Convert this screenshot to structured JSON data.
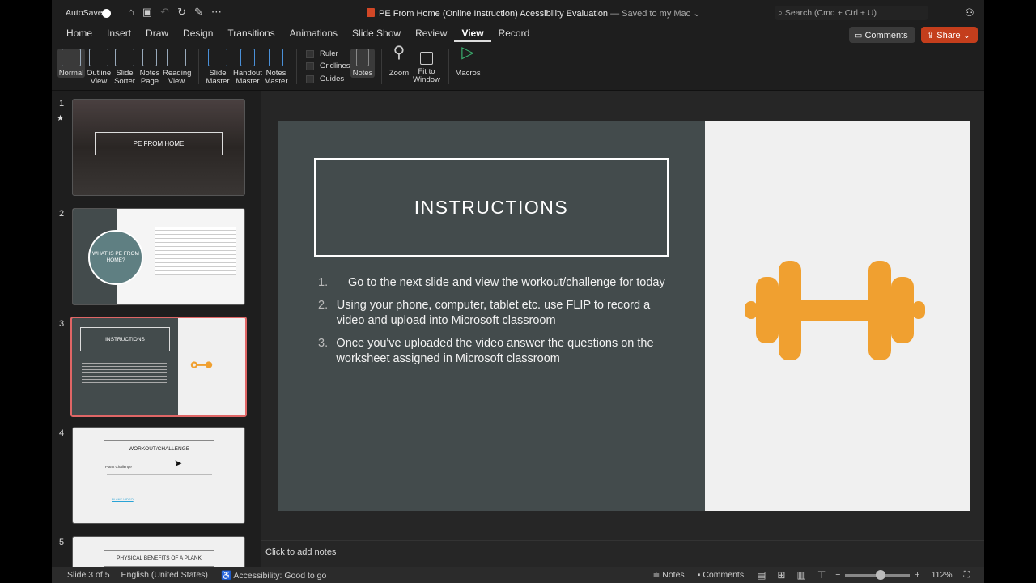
{
  "titlebar": {
    "autosave": "AutoSave",
    "doc_title": "PE From Home (Online Instruction) Acessibility Evaluation",
    "saved": "— Saved to my Mac",
    "search_placeholder": "Search (Cmd + Ctrl + U)",
    "comments": "Comments",
    "share": "Share"
  },
  "tabs": [
    "Home",
    "Insert",
    "Draw",
    "Design",
    "Transitions",
    "Animations",
    "Slide Show",
    "Review",
    "View",
    "Record"
  ],
  "ribbon": {
    "normal": "Normal",
    "outline": "Outline View",
    "sorter": "Slide Sorter",
    "notes_page": "Notes Page",
    "reading": "Reading View",
    "slide_master": "Slide Master",
    "handout_master": "Handout Master",
    "notes_master": "Notes Master",
    "ruler": "Ruler",
    "gridlines": "Gridlines",
    "guides": "Guides",
    "notes": "Notes",
    "zoom": "Zoom",
    "fit": "Fit to Window",
    "macros": "Macros"
  },
  "thumbnails": [
    {
      "num": "1",
      "title": "PE FROM HOME"
    },
    {
      "num": "2",
      "title": "WHAT IS PE FROM HOME?"
    },
    {
      "num": "3",
      "title": "INSTRUCTIONS"
    },
    {
      "num": "4",
      "title": "WORKOUT/CHALLENGE",
      "sub": "Plank Challenge",
      "link": "PLANK VIDEO"
    },
    {
      "num": "5",
      "title": "PHYSICAL BENEFITS OF A PLANK"
    }
  ],
  "slide": {
    "title": "INSTRUCTIONS",
    "items": [
      {
        "n": "1.",
        "text": "Go to the next slide and view the workout/challenge for today"
      },
      {
        "n": "2.",
        "text": "Using your phone, computer, tablet etc. use FLIP to record a video and upload into Microsoft classroom"
      },
      {
        "n": "3.",
        "text": "Once you've uploaded the video answer the questions on the worksheet assigned in Microsoft classroom"
      }
    ],
    "icon_color": "#f0a030"
  },
  "notes_placeholder": "Click to add notes",
  "status": {
    "slide": "Slide 3 of 5",
    "lang": "English (United States)",
    "access": "Accessibility: Good to go",
    "notes": "Notes",
    "comments": "Comments",
    "zoom": "112%",
    "zoom_fraction": 0.55
  }
}
